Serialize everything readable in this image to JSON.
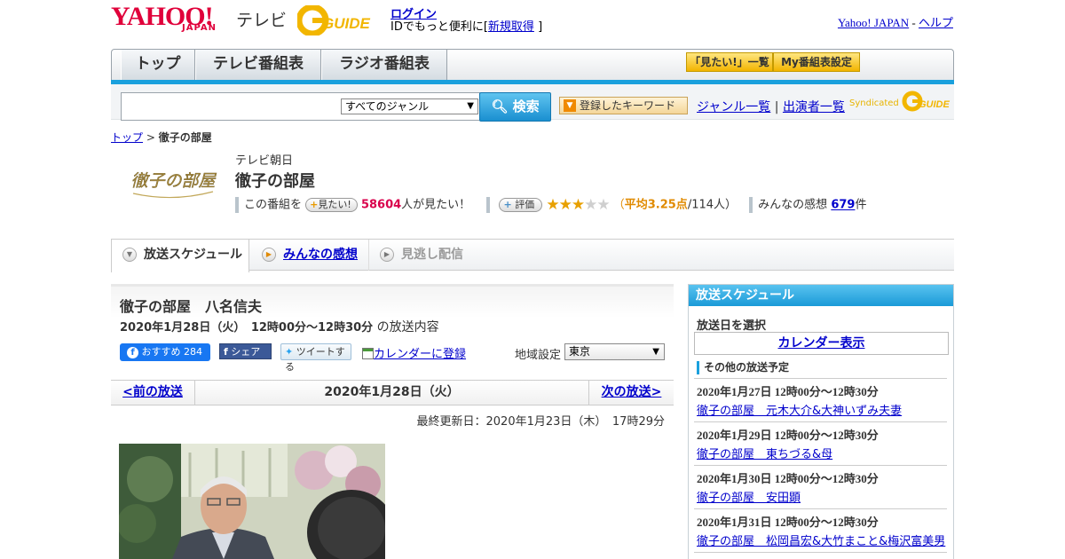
{
  "header": {
    "logo_yahoo": "YAHOO!",
    "logo_japan": "JAPAN",
    "logo_tv": "テレビ",
    "gguide": "G-GUIDE",
    "login": "ログイン",
    "login_text_prefix": "IDでもっと便利に[",
    "signup": "新規取得",
    "login_text_suffix": "]",
    "yahoo_japan_link": "Yahoo! JAPAN",
    "sep": "-",
    "help_link": "ヘルプ"
  },
  "nav": {
    "tabs": [
      {
        "label": "トップ"
      },
      {
        "label": "テレビ番組表"
      },
      {
        "label": "ラジオ番組表"
      }
    ],
    "mitai_list": "「見たい!」一覧",
    "my_settings": "My番組表設定"
  },
  "search": {
    "genre_selected": "すべてのジャンル",
    "button": "検索",
    "keyword_button": "登録したキーワード",
    "genre_list": "ジャンル一覧",
    "divider": "|",
    "cast_list": "出演者一覧",
    "syndicated": "Syndicated"
  },
  "breadcrumb": {
    "top": "トップ",
    "sep": " > ",
    "current": "徹子の部屋"
  },
  "program": {
    "logo_text": "徹子の部屋",
    "channel": "テレビ朝日",
    "title": "徹子の部屋",
    "mitai_prefix": "この番組を",
    "mitai_pill": "見たい!",
    "mitai_count": "58604",
    "mitai_suffix": "人が見たい！",
    "rating_pill": "評価",
    "rating_value": 3,
    "rating_max": 5,
    "rating_open": "（",
    "rating_avg": "平均3.25点",
    "rating_people": "/114人）",
    "comments_prefix": "みんなの感想",
    "comments_count": "679",
    "comments_suffix": "件"
  },
  "subtabs": [
    {
      "label": "放送スケジュール"
    },
    {
      "label": "みんなの感想"
    },
    {
      "label": "見逃し配信"
    }
  ],
  "episode": {
    "title": "徹子の部屋　八名信夫",
    "date": "2020年1月28日（火）　12時00分～12時30分",
    "date_suffix": "の放送内容",
    "fb_label": "おすすめ",
    "fb_count": "284",
    "share": "シェア",
    "tweet": "ツイートする",
    "calendar": "カレンダーに登録",
    "region_label": "地域設定",
    "region_value": "東京",
    "prev": "<前の放送",
    "current_date": "2020年1月28日（火）",
    "next": "次の放送>",
    "updated": "最終更新日：2020年1月23日（木）　17時29分"
  },
  "sidebar": {
    "title": "放送スケジュール",
    "select_date": "放送日を選択",
    "calendar": "カレンダー表示",
    "other": "その他の放送予定",
    "items": [
      {
        "date": "2020年1月27日  12時00分～12時30分",
        "title": "徹子の部屋　元木大介&大神いずみ夫妻"
      },
      {
        "date": "2020年1月29日  12時00分～12時30分",
        "title": "徹子の部屋　東ちづる&母"
      },
      {
        "date": "2020年1月30日  12時00分～12時30分",
        "title": "徹子の部屋　安田顕"
      },
      {
        "date": "2020年1月31日  12時00分～12時30分",
        "title": "徹子の部屋　松岡昌宏&大竹まこと&梅沢富美男"
      }
    ]
  }
}
